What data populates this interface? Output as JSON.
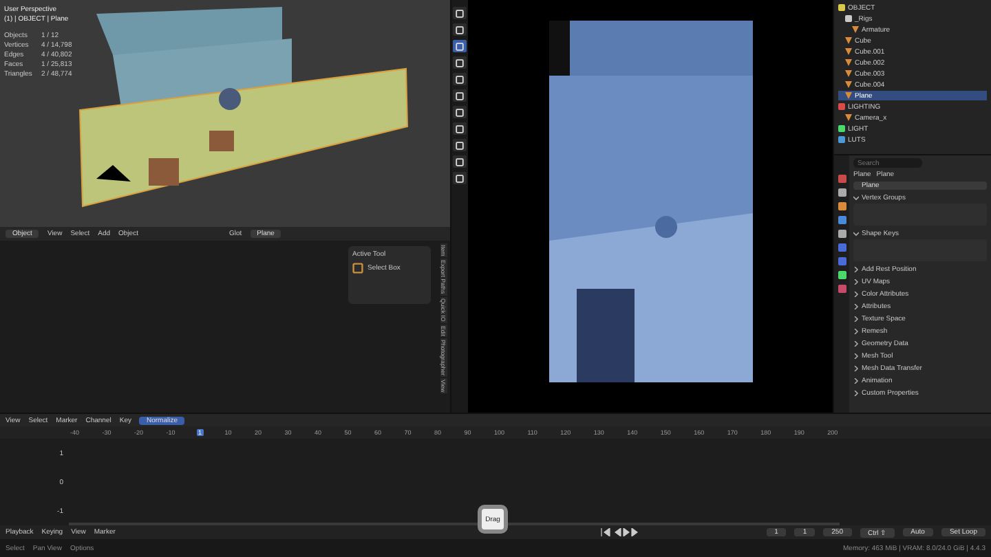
{
  "viewport": {
    "title": "User Perspective",
    "context": "(1) | OBJECT | Plane",
    "stats": [
      {
        "label": "Objects",
        "value": "1 / 12"
      },
      {
        "label": "Vertices",
        "value": "4 / 14,798"
      },
      {
        "label": "Edges",
        "value": "4 / 40,802"
      },
      {
        "label": "Faces",
        "value": "1 / 25,813"
      },
      {
        "label": "Triangles",
        "value": "2 / 48,774"
      }
    ]
  },
  "viewport_header": {
    "mode": "Object",
    "menus": [
      "View",
      "Select",
      "Add",
      "Object"
    ],
    "orientation": "Glot",
    "snap": "Plane"
  },
  "active_tool": {
    "title": "Active Tool",
    "tool": "Select Box"
  },
  "side_tabs": [
    "Item",
    "Export Paths",
    "Quick IO",
    "Edit",
    "Photographer",
    "View"
  ],
  "tools": [
    {
      "selected": false
    },
    {
      "selected": false
    },
    {
      "selected": true
    },
    {
      "selected": false
    },
    {
      "selected": false
    },
    {
      "selected": false
    },
    {
      "selected": false
    },
    {
      "selected": false
    },
    {
      "selected": false
    },
    {
      "selected": false
    },
    {
      "selected": false
    }
  ],
  "outliner": [
    {
      "name": "OBJECT",
      "kind": "collection",
      "color": "#d9c94a",
      "selected": false,
      "children": [
        {
          "name": "_Rigs",
          "kind": "collection",
          "color": "#c8c8c8",
          "selected": false,
          "children": [
            {
              "name": "Armature",
              "kind": "object",
              "color": "#d98a3a",
              "selected": false
            }
          ]
        },
        {
          "name": "Cube",
          "kind": "object",
          "color": "#d98a3a",
          "selected": false
        },
        {
          "name": "Cube.001",
          "kind": "object",
          "color": "#d98a3a",
          "selected": false
        },
        {
          "name": "Cube.002",
          "kind": "object",
          "color": "#d98a3a",
          "selected": false
        },
        {
          "name": "Cube.003",
          "kind": "object",
          "color": "#d98a3a",
          "selected": false
        },
        {
          "name": "Cube.004",
          "kind": "object",
          "color": "#d98a3a",
          "selected": false
        },
        {
          "name": "Plane",
          "kind": "object",
          "color": "#d98a3a",
          "selected": true
        }
      ]
    },
    {
      "name": "LIGHTING",
      "kind": "collection",
      "color": "#d94a4a",
      "selected": false,
      "children": [
        {
          "name": "Camera_x",
          "kind": "object",
          "color": "#d98a3a",
          "selected": false
        }
      ]
    },
    {
      "name": "LIGHT",
      "kind": "collection",
      "color": "#4ad96a",
      "selected": false
    },
    {
      "name": "LUTS",
      "kind": "collection",
      "color": "#4a9ad9",
      "selected": false
    }
  ],
  "properties": {
    "search": {
      "placeholder": "Search"
    },
    "breadcrumb": [
      "Plane",
      "Plane"
    ],
    "mesh_name": "Plane",
    "panels": [
      {
        "title": "Vertex Groups",
        "expanded": true
      },
      {
        "title": "Shape Keys",
        "expanded": true
      },
      {
        "title": "Add Rest Position",
        "expanded": false
      },
      {
        "title": "UV Maps",
        "expanded": false
      },
      {
        "title": "Color Attributes",
        "expanded": false
      },
      {
        "title": "Attributes",
        "expanded": false
      },
      {
        "title": "Texture Space",
        "expanded": false
      },
      {
        "title": "Remesh",
        "expanded": false
      },
      {
        "title": "Geometry Data",
        "expanded": false
      },
      {
        "title": "Mesh Tool",
        "expanded": false
      },
      {
        "title": "Mesh Data Transfer",
        "expanded": false
      },
      {
        "title": "Animation",
        "expanded": false
      },
      {
        "title": "Custom Properties",
        "expanded": false
      }
    ]
  },
  "timeline": {
    "menus": [
      "View",
      "Select",
      "Marker",
      "Channel",
      "Key"
    ],
    "normalize": {
      "label": "Normalize",
      "on": true
    },
    "ticks": [
      "-40",
      "-30",
      "-20",
      "-10",
      "1",
      "10",
      "20",
      "30",
      "40",
      "50",
      "60",
      "70",
      "80",
      "90",
      "100",
      "110",
      "120",
      "130",
      "140",
      "150",
      "160",
      "170",
      "180",
      "190",
      "200"
    ],
    "rows": [
      "1",
      "0",
      "-1"
    ]
  },
  "playback": {
    "menus": [
      "Playback",
      "Keying",
      "View",
      "Marker"
    ],
    "frame": "1",
    "start": "1",
    "end": "250",
    "buttons": [
      "Ctrl ⇧",
      "Auto",
      "Set Loop"
    ]
  },
  "tooltip": "Drag",
  "status_bar": {
    "hints": [
      "Select",
      "Pan View",
      "Options"
    ],
    "info": "Memory: 463 MiB | VRAM: 8.0/24.0 GiB | 4.4.3"
  }
}
